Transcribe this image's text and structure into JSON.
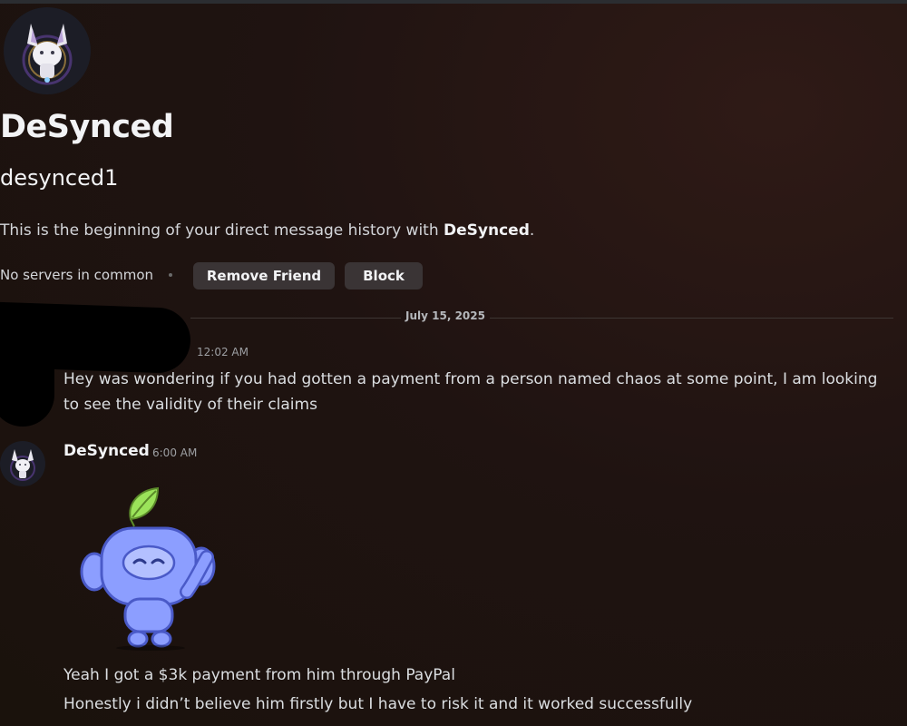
{
  "profile": {
    "display_name": "DeSynced",
    "username": "desynced1",
    "intro_prefix": "This is the beginning of your direct message history with ",
    "intro_name": "DeSynced",
    "intro_suffix": ".",
    "servers_text": "No servers in common",
    "remove_friend_label": "Remove Friend",
    "block_label": "Block",
    "avatar_icon": "fox-character-avatar"
  },
  "divider": {
    "date": "July 15, 2025"
  },
  "messages": [
    {
      "author": "",
      "time": "12:02 AM",
      "text": "Hey was wondering if you had gotten a payment from a person named chaos at some point, I am looking to see the validity of their claims"
    },
    {
      "author": "DeSynced",
      "time": "6:00 AM",
      "sticker": "wumpus-leaf-sticker",
      "lines": [
        "Yeah I got a $3k payment from him through PayPal",
        "Honestly i didn’t believe him firstly but I have to risk it and it worked successfully"
      ]
    }
  ],
  "colors": {
    "background": "#1f1311",
    "button": "#3a3435",
    "wumpus": "#8c9eff",
    "leaf": "#9be35a"
  }
}
